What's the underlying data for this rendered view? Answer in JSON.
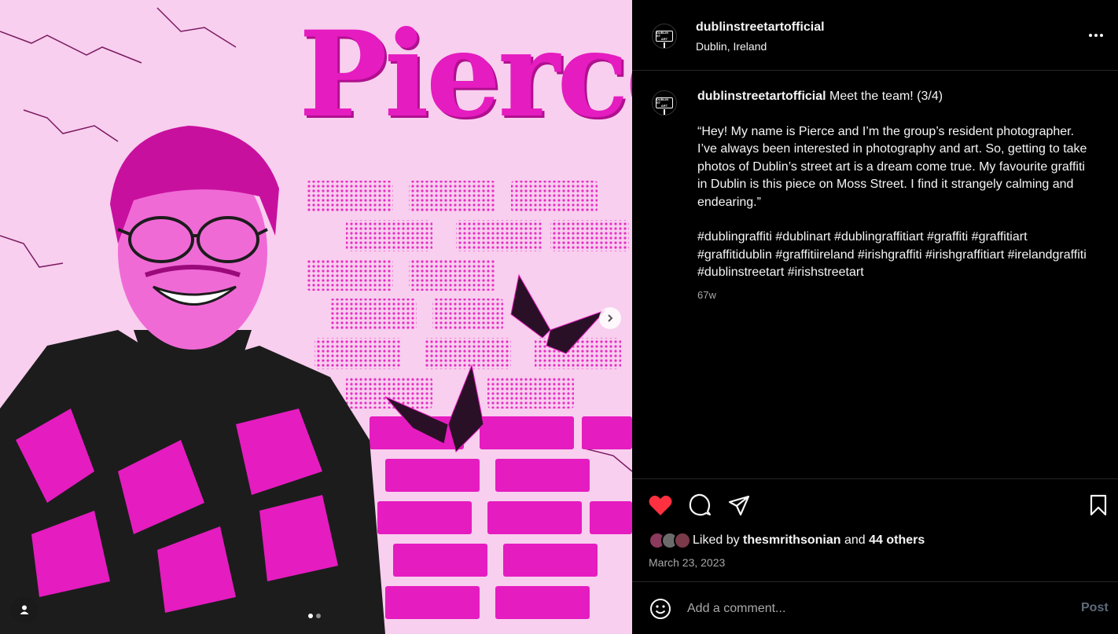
{
  "media": {
    "image_title": "Pierce",
    "carousel_dots": 2,
    "active_dot": 0
  },
  "header": {
    "username": "dublinstreetartofficial",
    "location": "Dublin, Ireland",
    "avatar_text_top": "DUBLIN ST",
    "avatar_text_bottom": "ART"
  },
  "caption": {
    "username": "dublinstreetartofficial",
    "headline": "Meet the team! (3/4)",
    "body": "“Hey! My name is Pierce and I’m the group’s resident photographer. I’ve always been interested in photography and art. So, getting to take photos of Dublin’s street art is a dream come true. My favourite graffiti in Dublin is this piece on Moss Street. I find it strangely calming and endearing.”",
    "hashtags": "#dublingraffiti #dublinart #dublingraffitiart #graffiti #graffitiart #graffitidublin #graffitiireland #irishgraffiti #irishgraffitiart #irelandgraffiti #dublinstreetart #irishstreetart",
    "time_ago": "67w"
  },
  "actions": {
    "liked": true,
    "liked_by_prefix": "Liked by",
    "liked_by_user": "thesmrithsonian",
    "and_text": "and",
    "others": "44 others",
    "date": "March 23, 2023",
    "like_color": "#ff3040"
  },
  "comment": {
    "placeholder": "Add a comment...",
    "post_label": "Post"
  },
  "icons": [
    "more-icon",
    "heart-icon",
    "comment-icon",
    "share-icon",
    "bookmark-icon",
    "emoji-icon",
    "chevron-right-icon",
    "user-tag-icon"
  ],
  "colors": {
    "accent_pink": "#e51cc0",
    "background_pink": "#f8cfee",
    "panel_bg": "#000000",
    "muted_text": "#a8a8a8"
  }
}
